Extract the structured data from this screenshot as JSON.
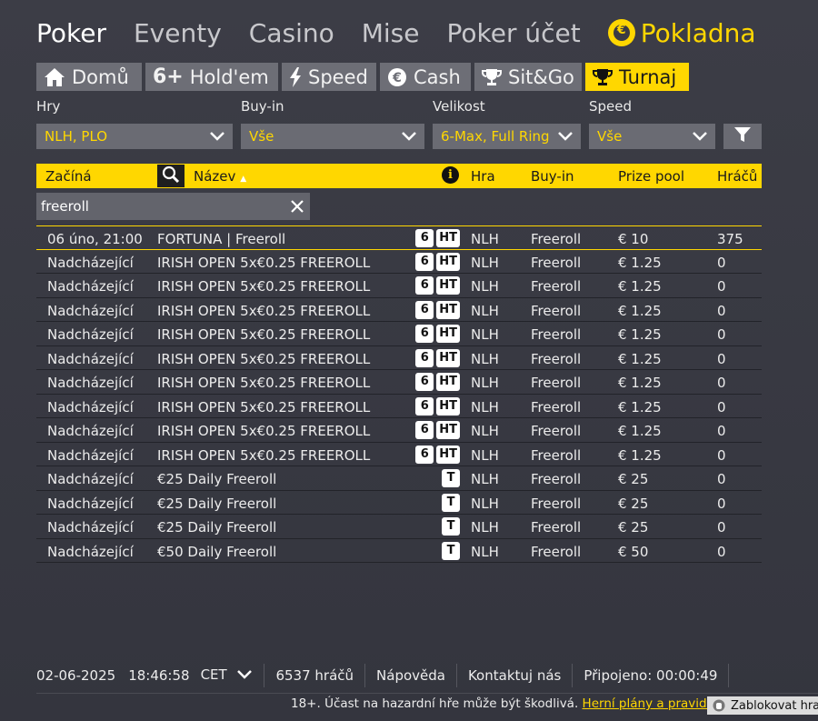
{
  "topnav": {
    "items": [
      "Poker",
      "Eventy",
      "Casino",
      "Mise",
      "Poker účet"
    ],
    "cashier": "Pokladna"
  },
  "tabs": [
    {
      "label": "Domů",
      "icon": "home-icon"
    },
    {
      "label": "Hold'em",
      "icon": "six-plus-icon",
      "icon_text": "6+"
    },
    {
      "label": "Speed",
      "icon": "lightning-icon"
    },
    {
      "label": "Cash",
      "icon": "euro-icon"
    },
    {
      "label": "Sit&Go",
      "icon": "trophy-icon"
    },
    {
      "label": "Turnaj",
      "icon": "trophy-cup-icon",
      "active": true
    }
  ],
  "filters": {
    "games": {
      "label": "Hry",
      "value": "NLH, PLO"
    },
    "buyin": {
      "label": "Buy-in",
      "value": "Vše"
    },
    "size": {
      "label": "Velikost",
      "value": "6-Max, Full Ring"
    },
    "speed": {
      "label": "Speed",
      "value": "Vše"
    }
  },
  "table": {
    "headers": {
      "starts": "Začíná",
      "name": "Název",
      "sort_indicator": "▲",
      "info": "i",
      "game": "Hra",
      "buyin": "Buy-in",
      "prize": "Prize pool",
      "players": "Hráčů"
    },
    "search_value": "freeroll",
    "rows": [
      {
        "starts": "06 úno, 21:00",
        "name": "FORTUNA | Freeroll",
        "badges": [
          "6",
          "HT"
        ],
        "game": "NLH",
        "buyin": "Freeroll",
        "prize": "€ 10",
        "players": "375"
      },
      {
        "starts": "Nadcházející",
        "name": "IRISH OPEN 5x€0.25 FREEROLL",
        "badges": [
          "6",
          "HT"
        ],
        "game": "NLH",
        "buyin": "Freeroll",
        "prize": "€ 1.25",
        "players": "0"
      },
      {
        "starts": "Nadcházející",
        "name": "IRISH OPEN 5x€0.25 FREEROLL",
        "badges": [
          "6",
          "HT"
        ],
        "game": "NLH",
        "buyin": "Freeroll",
        "prize": "€ 1.25",
        "players": "0"
      },
      {
        "starts": "Nadcházející",
        "name": "IRISH OPEN 5x€0.25 FREEROLL",
        "badges": [
          "6",
          "HT"
        ],
        "game": "NLH",
        "buyin": "Freeroll",
        "prize": "€ 1.25",
        "players": "0"
      },
      {
        "starts": "Nadcházející",
        "name": "IRISH OPEN 5x€0.25 FREEROLL",
        "badges": [
          "6",
          "HT"
        ],
        "game": "NLH",
        "buyin": "Freeroll",
        "prize": "€ 1.25",
        "players": "0"
      },
      {
        "starts": "Nadcházející",
        "name": "IRISH OPEN 5x€0.25 FREEROLL",
        "badges": [
          "6",
          "HT"
        ],
        "game": "NLH",
        "buyin": "Freeroll",
        "prize": "€ 1.25",
        "players": "0"
      },
      {
        "starts": "Nadcházející",
        "name": "IRISH OPEN 5x€0.25 FREEROLL",
        "badges": [
          "6",
          "HT"
        ],
        "game": "NLH",
        "buyin": "Freeroll",
        "prize": "€ 1.25",
        "players": "0"
      },
      {
        "starts": "Nadcházející",
        "name": "IRISH OPEN 5x€0.25 FREEROLL",
        "badges": [
          "6",
          "HT"
        ],
        "game": "NLH",
        "buyin": "Freeroll",
        "prize": "€ 1.25",
        "players": "0"
      },
      {
        "starts": "Nadcházející",
        "name": "IRISH OPEN 5x€0.25 FREEROLL",
        "badges": [
          "6",
          "HT"
        ],
        "game": "NLH",
        "buyin": "Freeroll",
        "prize": "€ 1.25",
        "players": "0"
      },
      {
        "starts": "Nadcházející",
        "name": "IRISH OPEN 5x€0.25 FREEROLL",
        "badges": [
          "6",
          "HT"
        ],
        "game": "NLH",
        "buyin": "Freeroll",
        "prize": "€ 1.25",
        "players": "0"
      },
      {
        "starts": "Nadcházející",
        "name": "€25 Daily Freeroll",
        "badges": [
          "T"
        ],
        "game": "NLH",
        "buyin": "Freeroll",
        "prize": "€ 25",
        "players": "0"
      },
      {
        "starts": "Nadcházející",
        "name": "€25 Daily Freeroll",
        "badges": [
          "T"
        ],
        "game": "NLH",
        "buyin": "Freeroll",
        "prize": "€ 25",
        "players": "0"
      },
      {
        "starts": "Nadcházející",
        "name": "€25 Daily Freeroll",
        "badges": [
          "T"
        ],
        "game": "NLH",
        "buyin": "Freeroll",
        "prize": "€ 25",
        "players": "0"
      },
      {
        "starts": "Nadcházející",
        "name": "€50 Daily Freeroll",
        "badges": [
          "T"
        ],
        "game": "NLH",
        "buyin": "Freeroll",
        "prize": "€ 50",
        "players": "0"
      }
    ]
  },
  "footer": {
    "date": "02-06-2025",
    "time": "18:46:58",
    "timezone": "CET",
    "players": "6537 hráčů",
    "help": "Nápověda",
    "contact": "Kontaktuj nás",
    "connected": "Připojeno: 00:00:49",
    "disclaimer": "18+. Účast na hazardní hře může být škodlivá.",
    "disclaimer_link": "Herní plány a pravidla.",
    "block_button": "Zablokovat hrani"
  },
  "colors": {
    "accent": "#ffd700",
    "background": "#3a3b44",
    "tab_inactive": "#6d6e76",
    "select_bg": "#6a6b73"
  }
}
